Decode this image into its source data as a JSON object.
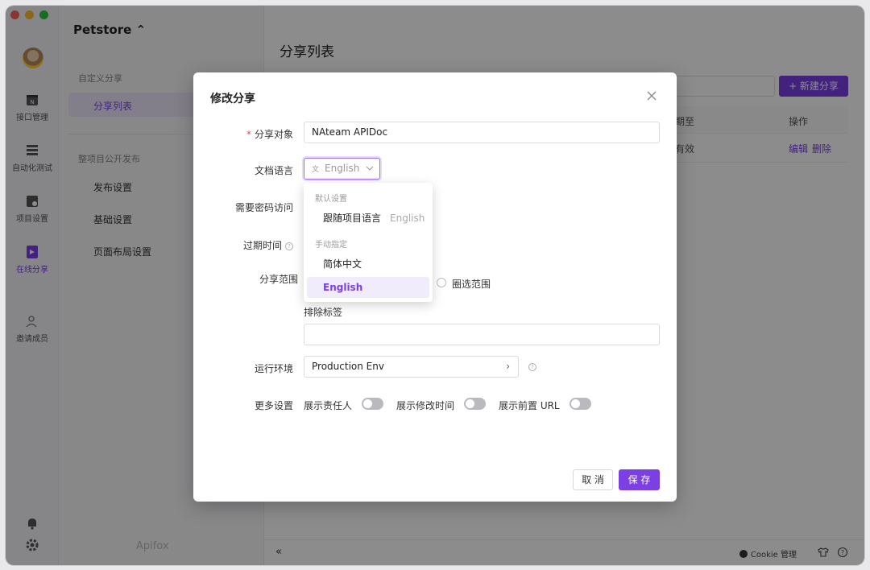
{
  "window": {
    "traffic": [
      "#ff5f57",
      "#febc2e",
      "#28c840"
    ]
  },
  "rail": {
    "items": [
      {
        "label": "接口管理",
        "icon": "api-calendar-icon"
      },
      {
        "label": "自动化测试",
        "icon": "automation-stack-icon"
      },
      {
        "label": "项目设置",
        "icon": "project-settings-icon"
      },
      {
        "label": "在线分享",
        "icon": "online-share-icon"
      },
      {
        "label": "邀请成员",
        "icon": "invite-member-icon"
      }
    ]
  },
  "nav": {
    "project": "Petstore ⌃",
    "section1": "自定义分享",
    "item_active": "分享列表",
    "section2": "整项目公开发布",
    "items": [
      "发布设置",
      "基础设置",
      "页面布局设置"
    ],
    "brand": "Apifox"
  },
  "main": {
    "title": "分享列表",
    "new_button": "+ 新建分享",
    "col_expire": "期至",
    "col_ops": "操作",
    "row_expire": "有效",
    "row_edit": "编辑",
    "row_delete": "删除",
    "collapse": "«",
    "cookie": "Cookie 管理"
  },
  "modal": {
    "title": "修改分享",
    "share_target_label": "分享对象",
    "share_target_value": "NAteam APIDoc",
    "doc_lang_label": "文档语言",
    "doc_lang_value": "English",
    "password_label": "需要密码访问",
    "expire_label": "过期时间",
    "scope_label": "分享范围",
    "scope_option": "圈选范围",
    "exclude_label": "排除标签",
    "env_label": "运行环境",
    "env_value": "Production Env",
    "more_label": "更多设置",
    "toggle_owner": "展示责任人",
    "toggle_mtime": "展示修改时间",
    "toggle_url": "展示前置 URL",
    "cancel": "取 消",
    "save": "保 存"
  },
  "dropdown": {
    "group_default": "默认设置",
    "follow_project": "跟随项目语言",
    "follow_project_hint": "English",
    "group_manual": "手动指定",
    "opt_zh": "简体中文",
    "opt_en": "English"
  },
  "colors": {
    "accent": "#7b3fe4",
    "required": "#e5484d"
  }
}
